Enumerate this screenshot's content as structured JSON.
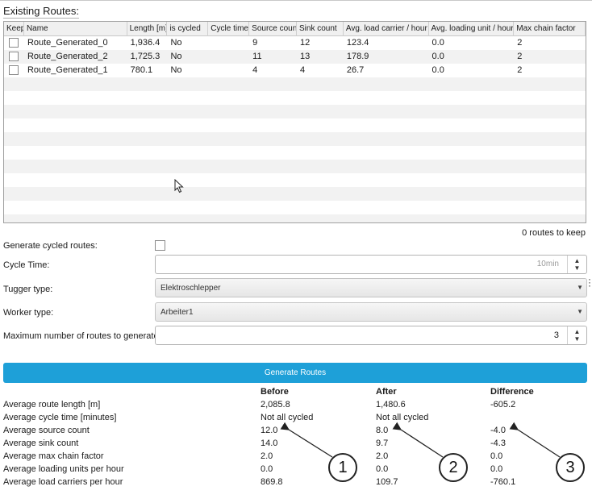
{
  "section_title": "Existing Routes:",
  "table": {
    "headers": [
      "Keep",
      "Name",
      "Length [m]",
      "is cycled",
      "Cycle time",
      "Source count",
      "Sink count",
      "Avg. load carrier / hour",
      "Avg. loading unit / hour",
      "Max chain factor"
    ],
    "rows": [
      {
        "name": "Route_Generated_0",
        "length": "1,936.4",
        "cycled": "No",
        "cycle_time": "",
        "source": "9",
        "sink": "12",
        "avg_load_carrier": "123.4",
        "avg_loading_unit": "0.0",
        "max_chain": "2"
      },
      {
        "name": "Route_Generated_2",
        "length": "1,725.3",
        "cycled": "No",
        "cycle_time": "",
        "source": "11",
        "sink": "13",
        "avg_load_carrier": "178.9",
        "avg_loading_unit": "0.0",
        "max_chain": "2"
      },
      {
        "name": "Route_Generated_1",
        "length": "780.1",
        "cycled": "No",
        "cycle_time": "",
        "source": "4",
        "sink": "4",
        "avg_load_carrier": "26.7",
        "avg_loading_unit": "0.0",
        "max_chain": "2"
      }
    ]
  },
  "keep_count": "0 routes to keep",
  "form": {
    "generate_cycled_label": "Generate cycled routes:",
    "cycle_time_label": "Cycle Time:",
    "cycle_time_value": "10min",
    "tugger_label": "Tugger type:",
    "tugger_value": "Elektroschlepper",
    "worker_label": "Worker type:",
    "worker_value": "Arbeiter1",
    "max_routes_label": "Maximum number of routes to generate:",
    "max_routes_value": "3"
  },
  "generate_button": "Generate Routes",
  "stats": {
    "headers": {
      "before": "Before",
      "after": "After",
      "difference": "Difference"
    },
    "rows": [
      {
        "label": "Average route length [m]",
        "before": "2,085.8",
        "after": "1,480.6",
        "diff": "-605.2"
      },
      {
        "label": "Average cycle time [minutes]",
        "before": "Not all cycled",
        "after": "Not all cycled",
        "diff": ""
      },
      {
        "label": "Average source count",
        "before": "12.0",
        "after": "8.0",
        "diff": "-4.0"
      },
      {
        "label": "Average sink count",
        "before": "14.0",
        "after": "9.7",
        "diff": "-4.3"
      },
      {
        "label": "Average max chain factor",
        "before": "2.0",
        "after": "2.0",
        "diff": "0.0"
      },
      {
        "label": "Average loading units per hour",
        "before": "0.0",
        "after": "0.0",
        "diff": "0.0"
      },
      {
        "label": "Average load carriers per hour",
        "before": "869.8",
        "after": "109.7",
        "diff": "-760.1"
      }
    ]
  },
  "callouts": [
    "1",
    "2",
    "3"
  ],
  "colors": {
    "accent": "#1ea0d8",
    "row_alt": "#f2f2f2"
  }
}
